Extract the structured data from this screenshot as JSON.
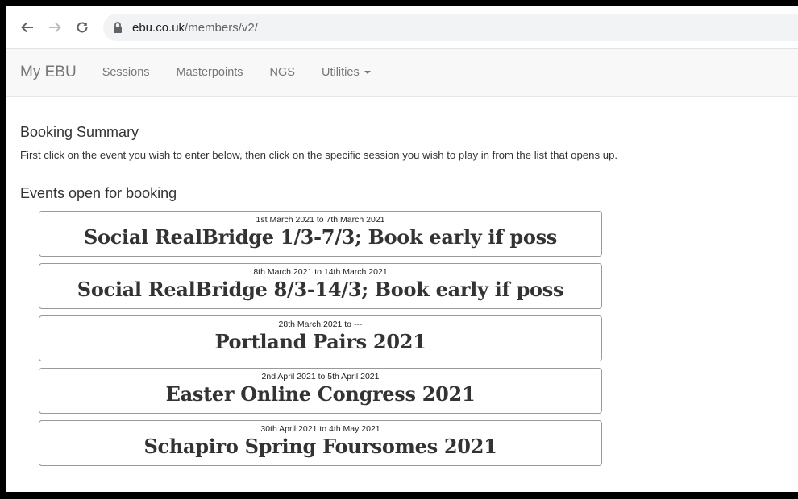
{
  "browser": {
    "url_host": "ebu.co.uk",
    "url_path": "/members/v2/"
  },
  "navbar": {
    "brand": "My EBU",
    "links": [
      "Sessions",
      "Masterpoints",
      "NGS",
      "Utilities"
    ]
  },
  "page": {
    "booking_heading": "Booking Summary",
    "instructions": "First click on the event you wish to enter below, then click on the specific session you wish to play in from the list that opens up.",
    "events_heading": "Events open for booking"
  },
  "events": [
    {
      "dates": "1st March 2021 to 7th March 2021",
      "title": "Social RealBridge 1/3-7/3; Book early if poss"
    },
    {
      "dates": "8th March 2021 to 14th March 2021",
      "title": "Social RealBridge 8/3-14/3; Book early if poss"
    },
    {
      "dates": "28th March 2021 to ---",
      "title": "Portland Pairs 2021"
    },
    {
      "dates": "2nd April 2021 to 5th April 2021",
      "title": "Easter Online Congress 2021"
    },
    {
      "dates": "30th April 2021 to 4th May 2021",
      "title": "Schapiro Spring Foursomes 2021"
    }
  ]
}
